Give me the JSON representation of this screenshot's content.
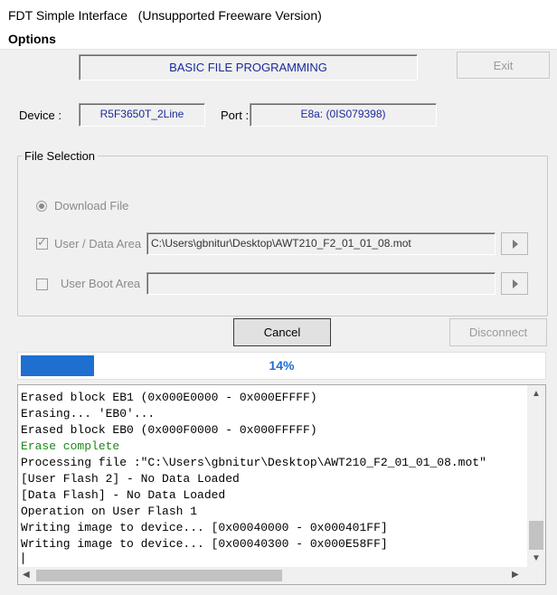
{
  "window": {
    "title": "FDT Simple Interface   (Unsupported Freeware Version)"
  },
  "menu": {
    "options": "Options"
  },
  "header": {
    "mode": "BASIC FILE PROGRAMMING",
    "exit_label": "Exit"
  },
  "device": {
    "label": "Device :",
    "value": "R5F3650T_2Line"
  },
  "port": {
    "label": "Port :",
    "value": "E8a: (0IS079398)"
  },
  "file_selection": {
    "title": "File Selection",
    "download_file": "Download File",
    "user_data_area": "User / Data Area",
    "user_data_path": "C:\\Users\\gbnitur\\Desktop\\AWT210_F2_01_01_08.mot",
    "user_boot_area": "User Boot Area",
    "user_boot_path": ""
  },
  "actions": {
    "cancel": "Cancel",
    "disconnect": "Disconnect"
  },
  "progress": {
    "value": 0.14,
    "label": "14%"
  },
  "log": {
    "lines": [
      {
        "text": "Erased block EB1 (0x000E0000 - 0x000EFFFF)",
        "status": "normal"
      },
      {
        "text": "Erasing... 'EB0'...",
        "status": "normal"
      },
      {
        "text": "Erased block EB0 (0x000F0000 - 0x000FFFFF)",
        "status": "normal"
      },
      {
        "text": "Erase complete",
        "status": "success"
      },
      {
        "text": "Processing file :\"C:\\Users\\gbnitur\\Desktop\\AWT210_F2_01_01_08.mot\"",
        "status": "normal"
      },
      {
        "text": "[User Flash 2] - No Data Loaded",
        "status": "normal"
      },
      {
        "text": "[Data Flash] - No Data Loaded",
        "status": "normal"
      },
      {
        "text": "Operation on User Flash 1",
        "status": "normal"
      },
      {
        "text": "Writing image to device... [0x00040000 - 0x000401FF]",
        "status": "normal"
      },
      {
        "text": "Writing image to device... [0x00040300 - 0x000E58FF]",
        "status": "normal"
      }
    ]
  },
  "colors": {
    "accent": "#1e6fd0",
    "banner_text": "#1a2a9a",
    "success": "#1a8a1a"
  },
  "icons": {
    "scroll_up": "chevron-up-icon",
    "scroll_down": "chevron-down-icon",
    "scroll_left": "chevron-left-icon",
    "scroll_right": "chevron-right-icon",
    "browse": "play-arrow-icon"
  }
}
